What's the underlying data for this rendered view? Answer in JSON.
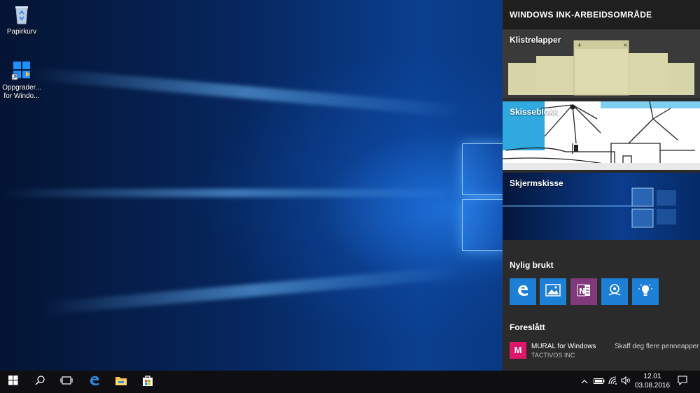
{
  "desktop": {
    "icons": [
      {
        "label": "Papirkurv",
        "icon": "recycle-bin-icon"
      },
      {
        "label_line1": "Oppgrader...",
        "label_line2": "for Windo...",
        "icon": "windows-upgrade-icon"
      }
    ]
  },
  "ink_workspace": {
    "title": "WINDOWS INK-ARBEIDSOMRÅDE",
    "tiles": {
      "sticky_notes": "Klistrelapper",
      "sketchpad": "Skisseblokk",
      "screen_sketch": "Skjermskisse"
    },
    "recent_title": "Nylig brukt",
    "recent_apps": [
      {
        "icon": "edge-icon",
        "color": "#1e7fd6"
      },
      {
        "icon": "photos-icon",
        "color": "#1e7fd6"
      },
      {
        "icon": "onenote-icon",
        "color": "#80397b"
      },
      {
        "icon": "maps-icon",
        "color": "#1e7fd6"
      },
      {
        "icon": "tips-icon",
        "color": "#1e7fd6"
      }
    ],
    "suggested_title": "Foreslått",
    "suggested": {
      "app_name": "MURAL for Windows",
      "publisher": "TACTIVOS INC",
      "get_more": "Skaff deg flere penneapper"
    }
  },
  "taskbar": {
    "items": [
      "start-icon",
      "search-icon",
      "task-view-icon",
      "edge-icon",
      "file-explorer-icon",
      "store-icon"
    ],
    "tray": [
      "chevron-up-icon",
      "battery-icon",
      "wifi-icon",
      "volume-icon"
    ],
    "time": "12.01",
    "date": "03.08.2016"
  },
  "colors": {
    "accent": "#1e7fd6",
    "panel": "#2b2b2b",
    "taskbar": "#0f0f12",
    "mural": "#e0156c"
  }
}
